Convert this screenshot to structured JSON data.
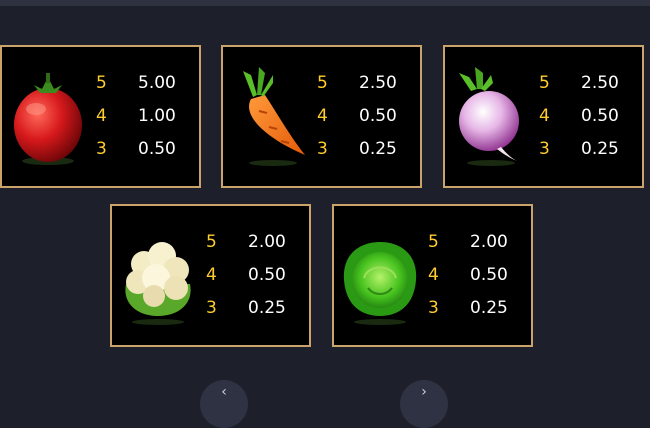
{
  "paytable": [
    {
      "symbol": "tomato-icon",
      "rows": [
        {
          "count": "5",
          "payout": "5.00"
        },
        {
          "count": "4",
          "payout": "1.00"
        },
        {
          "count": "3",
          "payout": "0.50"
        }
      ]
    },
    {
      "symbol": "carrot-icon",
      "rows": [
        {
          "count": "5",
          "payout": "2.50"
        },
        {
          "count": "4",
          "payout": "0.50"
        },
        {
          "count": "3",
          "payout": "0.25"
        }
      ]
    },
    {
      "symbol": "turnip-icon",
      "rows": [
        {
          "count": "5",
          "payout": "2.50"
        },
        {
          "count": "4",
          "payout": "0.50"
        },
        {
          "count": "3",
          "payout": "0.25"
        }
      ]
    },
    {
      "symbol": "cauliflower-icon",
      "rows": [
        {
          "count": "5",
          "payout": "2.00"
        },
        {
          "count": "4",
          "payout": "0.50"
        },
        {
          "count": "3",
          "payout": "0.25"
        }
      ]
    },
    {
      "symbol": "cabbage-icon",
      "rows": [
        {
          "count": "5",
          "payout": "2.00"
        },
        {
          "count": "4",
          "payout": "0.50"
        },
        {
          "count": "3",
          "payout": "0.25"
        }
      ]
    }
  ],
  "colors": {
    "count": "#ffce2e",
    "payout": "#ffffff",
    "border": "#c9a36a",
    "background": "#1d1f2b"
  },
  "nav": {
    "prev_icon": "chevron-left-icon",
    "next_icon": "chevron-right-icon"
  }
}
